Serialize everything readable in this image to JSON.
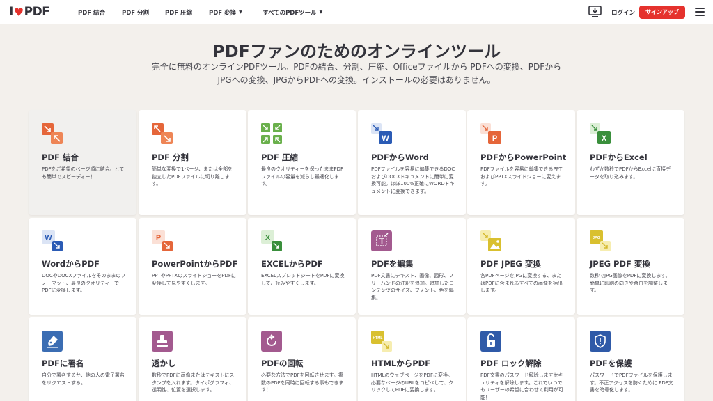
{
  "header": {
    "logo_left": "I",
    "logo_right": "PDF",
    "nav": [
      "PDF 結合",
      "PDF 分割",
      "PDF 圧縮",
      "PDF 変換",
      "すべてのPDFツール"
    ],
    "login": "ログイン",
    "signup": "サインアップ",
    "colors": {
      "brand": "#e5322d"
    }
  },
  "hero": {
    "title": "PDFファンのためのオンラインツール",
    "subtitle": "完全に無料のオンラインPDFツール。PDFの結合、分割、圧縮、Officeファイルから PDFへの変換、PDFからJPGへの変換、JPGからPDFへの変換。インストールの必要はありません。"
  },
  "tools": [
    {
      "title": "PDF 結合",
      "desc": "PDFをご希望のページ順に結合。とても簡単でスピーディー！",
      "icon": "merge-icon"
    },
    {
      "title": "PDF 分割",
      "desc": "簡単な変換で1ページ、または全部を独立したPDFファイルに切り離します。",
      "icon": "split-icon"
    },
    {
      "title": "PDF 圧縮",
      "desc": "最良のクオリティーを保ったままPDFファイルの容量を減らし最適化します。",
      "icon": "compress-icon"
    },
    {
      "title": "PDFからWord",
      "desc": "PDFファイルを容易に編集できるDOCおよびDOCXドキュメントに簡単に変換可能。ほぼ100%正確にWORDドキュメントに変換できます。",
      "icon": "pdf-to-word-icon"
    },
    {
      "title": "PDFからPowerPoint",
      "desc": "PDFファイルを容易に編集できるPPTおよびPPTXスライドショーに変えます。",
      "icon": "pdf-to-powerpoint-icon"
    },
    {
      "title": "PDFからExcel",
      "desc": "わずか数秒でPDFからExcelに直接データを取り込みます。",
      "icon": "pdf-to-excel-icon"
    },
    {
      "title": "WordからPDF",
      "desc": "DOCやDOCXファイルをそのままのフォーマット、最良のクオリティーでPDFに変換します。",
      "icon": "word-to-pdf-icon"
    },
    {
      "title": "PowerPointからPDF",
      "desc": "PPTやPPTXのスライドショーをPDFに変換して見やすくします。",
      "icon": "powerpoint-to-pdf-icon"
    },
    {
      "title": "EXCELからPDF",
      "desc": "EXCELスプレッドシートをPDFに変換して、読みやすくします。",
      "icon": "excel-to-pdf-icon"
    },
    {
      "title": "PDFを編集",
      "desc": "PDF文書にテキスト、画像、図形、フリーハンドの注釈を追加。追加したコンテンツのサイズ、フォント、色を編集。",
      "icon": "edit-pdf-icon"
    },
    {
      "title": "PDF JPEG 変換",
      "desc": "各PDFページをJPGに変換する、またはPDFに含まれるすべての画像を抽出します。",
      "icon": "pdf-to-jpg-icon"
    },
    {
      "title": "JPEG PDF 変換",
      "desc": "数秒でJPG画像をPDFに変換します。簡単に印刷の向きや余白を調整します。",
      "icon": "jpg-to-pdf-icon"
    },
    {
      "title": "PDFに署名",
      "desc": "自分で署名するか、他の人の電子署名をリクエストする。",
      "icon": "sign-pdf-icon"
    },
    {
      "title": "透かし",
      "desc": "数秒でPDFに画像またはテキストにスタンプを入れます。タイポグラフィ、透明性、位置を選択します。",
      "icon": "watermark-icon"
    },
    {
      "title": "PDFの回転",
      "desc": "必要な方法でPDFを回転させます。複数のPDFを同時に回転する事もできます！",
      "icon": "rotate-pdf-icon"
    },
    {
      "title": "HTMLからPDF",
      "desc": "HTMLのウェブページをPDFに変換。必要なページのURLをコピペして、クリックしてPDFに変換します。",
      "icon": "html-to-pdf-icon"
    },
    {
      "title": "PDF ロック解除",
      "desc": "PDF文書のパスワード解除しますセキュリティを解除します。これでいつでもユーザーの希望に合わせて利用が可能！",
      "icon": "unlock-pdf-icon"
    },
    {
      "title": "PDFを保護",
      "desc": "パスワードでPDFファイルを保護します。不正アクセスを防ぐために PDF文書を暗号化します。",
      "icon": "protect-pdf-icon"
    }
  ],
  "icon_labels": {
    "word": "W",
    "ppt": "P",
    "excel": "X",
    "jpg": "JPG",
    "html": "HTML"
  }
}
